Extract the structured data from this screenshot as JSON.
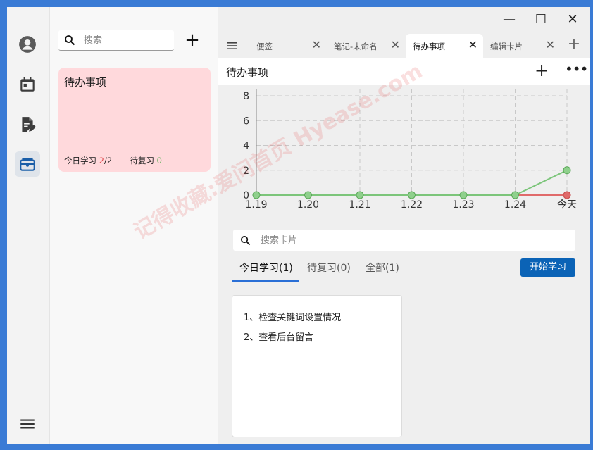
{
  "sidebar": {
    "items": [
      {
        "name": "user-icon"
      },
      {
        "name": "calendar-icon"
      },
      {
        "name": "edit-note-icon"
      },
      {
        "name": "flashcard-icon"
      },
      {
        "name": "menu-icon"
      }
    ],
    "active_index": 3
  },
  "notes_panel": {
    "search_placeholder": "搜索",
    "card": {
      "title": "待办事项",
      "today_label": "今日学习",
      "today_done": "2",
      "today_total": "/2",
      "review_label": "待复习",
      "review_count": "0"
    }
  },
  "tabs": [
    {
      "label": "便签"
    },
    {
      "label": "笔记-未命名"
    },
    {
      "label": "待办事项",
      "active": true
    },
    {
      "label": "编辑卡片"
    }
  ],
  "page": {
    "title": "待办事项"
  },
  "chart_data": {
    "type": "line",
    "categories": [
      "1.19",
      "1.20",
      "1.21",
      "1.22",
      "1.23",
      "1.24",
      "今天"
    ],
    "series": [
      {
        "values": [
          0,
          0,
          0,
          0,
          0,
          0,
          2
        ],
        "color": "#7cc57a"
      },
      {
        "values": [
          0,
          0,
          0,
          0,
          0,
          0,
          0
        ],
        "color": "#e06a6a"
      }
    ],
    "ylim": [
      0,
      8
    ],
    "yticks": [
      0,
      2,
      4,
      6,
      8
    ],
    "grid": true
  },
  "cards_section": {
    "search_placeholder": "搜索卡片",
    "filter_tabs": [
      {
        "label": "今日学习(1)",
        "active": true
      },
      {
        "label": "待复习(0)"
      },
      {
        "label": "全部(1)"
      }
    ],
    "start_button": "开始学习",
    "card_lines": [
      "1、检查关键词设置情况",
      "2、查看后台留言"
    ]
  },
  "watermark": "记得收藏:爱问首页 Hyease.com",
  "colors": {
    "accent": "#0b63b6",
    "card_bg": "#ffd9dc"
  }
}
